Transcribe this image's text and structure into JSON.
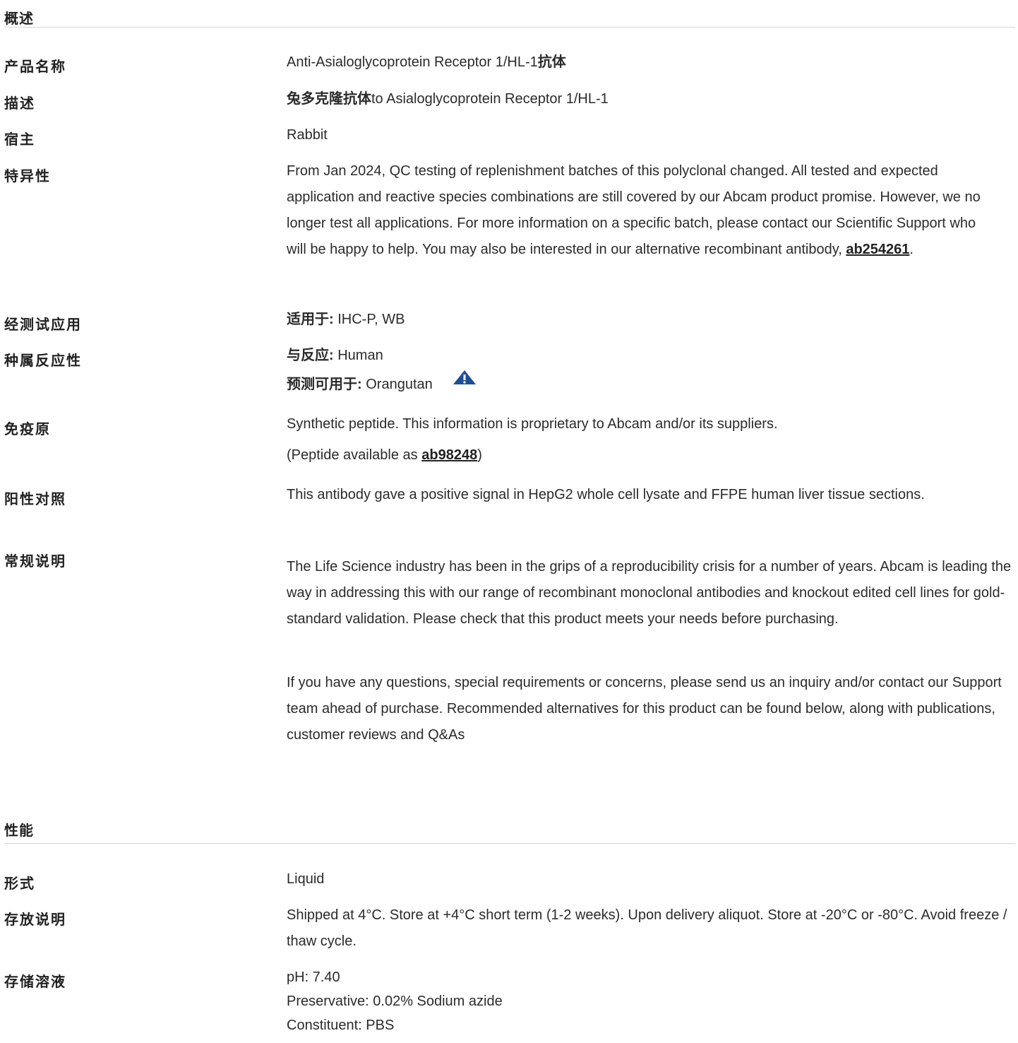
{
  "overview": {
    "title": "概述",
    "product_name": {
      "label": "产品名称",
      "value_a": "Anti-Asialoglycoprotein Receptor 1/HL-1",
      "value_b": "抗体"
    },
    "description": {
      "label": "描述",
      "value_a": "兔多克隆抗体",
      "value_b": "to Asialoglycoprotein Receptor 1/HL-1"
    },
    "host": {
      "label": "宿主",
      "value": "Rabbit"
    },
    "specificity": {
      "label": "特异性",
      "text": "From Jan 2024, QC testing of replenishment batches of this polyclonal changed. All tested and expected application and reactive species combinations are still covered by our Abcam product promise. However, we no longer test all applications. For more information on a specific batch, please contact our Scientific Support who will be happy to help. You may also be interested in our alternative recombinant antibody, ",
      "link": "ab254261",
      "after": "."
    },
    "tested_applications": {
      "label": "经测试应用",
      "prefix": "适用于:",
      "value": " IHC-P, WB"
    },
    "species_reactivity": {
      "label": "种属反应性",
      "reacts_prefix": "与反应:",
      "reacts_value": " Human",
      "predicted_prefix": "预测可用于:",
      "predicted_value": " Orangutan",
      "warning_icon": "warning-triangle-icon"
    },
    "immunogen": {
      "label": "免疫原",
      "line1": "Synthetic peptide. This information is proprietary to Abcam and/or its suppliers.",
      "line2_pre": "(Peptide available as ",
      "line2_link": "ab98248",
      "line2_post": ")"
    },
    "positive_control": {
      "label": "阳性对照",
      "text": "This antibody gave a positive signal in HepG2 whole cell lysate and FFPE human liver tissue sections."
    },
    "general_notes": {
      "label": "常规说明",
      "para1": "The Life Science industry has been in the grips of a reproducibility crisis for a number of years. Abcam is leading the way in addressing this with our range of recombinant monoclonal antibodies and knockout edited cell lines for gold-standard validation. Please check that this product meets your needs before purchasing.",
      "para2": "If you have any questions, special requirements or concerns, please send us an inquiry and/or contact our Support team ahead of purchase. Recommended alternatives for this product can be found below, along with publications, customer reviews and Q&As"
    }
  },
  "properties": {
    "title": "性能",
    "form": {
      "label": "形式",
      "value": "Liquid"
    },
    "storage": {
      "label": "存放说明",
      "text": "Shipped at 4°C. Store at +4°C short term (1-2 weeks). Upon delivery aliquot. Store at -20°C or -80°C. Avoid freeze / thaw cycle."
    },
    "buffer": {
      "label": "存储溶液",
      "line1": "pH: 7.40",
      "line2": "Preservative: 0.02% Sodium azide",
      "line3": "Constituent: PBS"
    }
  },
  "colors": {
    "text": "#2b2b2b",
    "rule": "#d5d5d5",
    "warning_icon": "#1f4e96"
  }
}
